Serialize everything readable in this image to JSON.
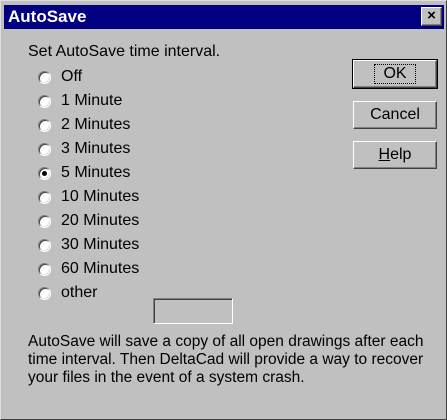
{
  "window": {
    "title": "AutoSave",
    "close_glyph": "×"
  },
  "prompt": "Set AutoSave time interval.",
  "options": [
    {
      "label": "Off",
      "checked": false
    },
    {
      "label": "1 Minute",
      "checked": false
    },
    {
      "label": "2 Minutes",
      "checked": false
    },
    {
      "label": "3 Minutes",
      "checked": false
    },
    {
      "label": "5 Minutes",
      "checked": true
    },
    {
      "label": "10 Minutes",
      "checked": false
    },
    {
      "label": "20 Minutes",
      "checked": false
    },
    {
      "label": "30 Minutes",
      "checked": false
    },
    {
      "label": "60 Minutes",
      "checked": false
    },
    {
      "label": "other",
      "checked": false
    }
  ],
  "other_value": "",
  "buttons": {
    "ok": "OK",
    "cancel": "Cancel",
    "help_prefix": "H",
    "help_rest": "elp"
  },
  "description": "AutoSave will save a copy of all open drawings after each time interval.  Then DeltaCad will provide a way to recover your files in the event of a system crash.",
  "colors": {
    "titlebar": "#000080",
    "face": "#c0c0c0"
  }
}
